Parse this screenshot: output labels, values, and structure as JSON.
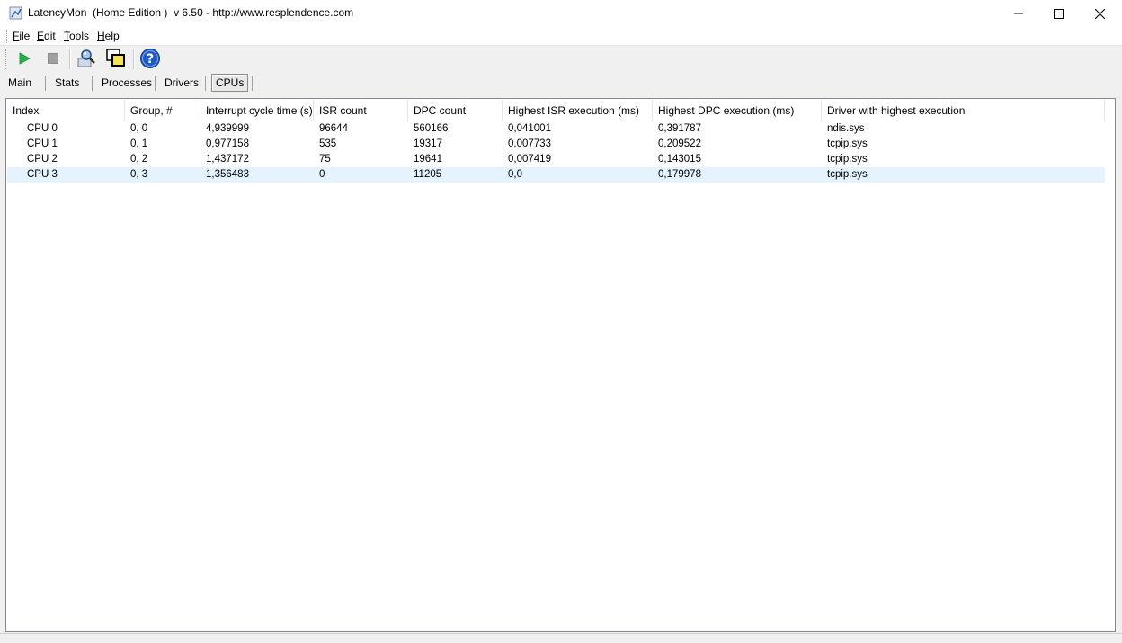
{
  "window": {
    "title": "LatencyMon  (Home Edition )  v 6.50 - http://www.resplendence.com",
    "controls": [
      "minimize-icon",
      "maximize-icon",
      "close-icon"
    ]
  },
  "menu": {
    "items": [
      {
        "label": "File",
        "accel": "F",
        "rest": "ile"
      },
      {
        "label": "Edit",
        "accel": "E",
        "rest": "dit"
      },
      {
        "label": "Tools",
        "accel": "T",
        "rest": "ools"
      },
      {
        "label": "Help",
        "accel": "H",
        "rest": "elp"
      }
    ]
  },
  "toolbar": {
    "buttons": [
      {
        "name": "start-button",
        "icon": "play-icon",
        "color": "#22b14c"
      },
      {
        "name": "stop-button",
        "icon": "stop-icon",
        "color": "#a0a0a0"
      },
      {
        "name": "search-button",
        "icon": "magnifier-icon"
      },
      {
        "name": "window-button",
        "icon": "windows-icon"
      },
      {
        "name": "help-button",
        "icon": "help-icon",
        "color": "#1e5bc6"
      }
    ]
  },
  "tabs": {
    "main": "Main",
    "stats": "Stats",
    "processes": "Processes",
    "drivers": "Drivers",
    "cpus": "CPUs",
    "active": "CPUs"
  },
  "table": {
    "columns": [
      "Index",
      "Group, #",
      "Interrupt cycle time (s)",
      "ISR count",
      "DPC count",
      "Highest ISR execution (ms)",
      "Highest DPC execution (ms)",
      "Driver with highest execution"
    ],
    "rows": [
      [
        "CPU 0",
        "0, 0",
        "4,939999",
        "96644",
        "560166",
        "0,041001",
        "0,391787",
        "ndis.sys"
      ],
      [
        "CPU 1",
        "0, 1",
        "0,977158",
        "535",
        "19317",
        "0,007733",
        "0,209522",
        "tcpip.sys"
      ],
      [
        "CPU 2",
        "0, 2",
        "1,437172",
        "75",
        "19641",
        "0,007419",
        "0,143015",
        "tcpip.sys"
      ],
      [
        "CPU 3",
        "0, 3",
        "1,356483",
        "0",
        "11205",
        "0,0",
        "0,179978",
        "tcpip.sys"
      ]
    ],
    "selected_row": 3,
    "selection_color": "#e5f3ff"
  }
}
